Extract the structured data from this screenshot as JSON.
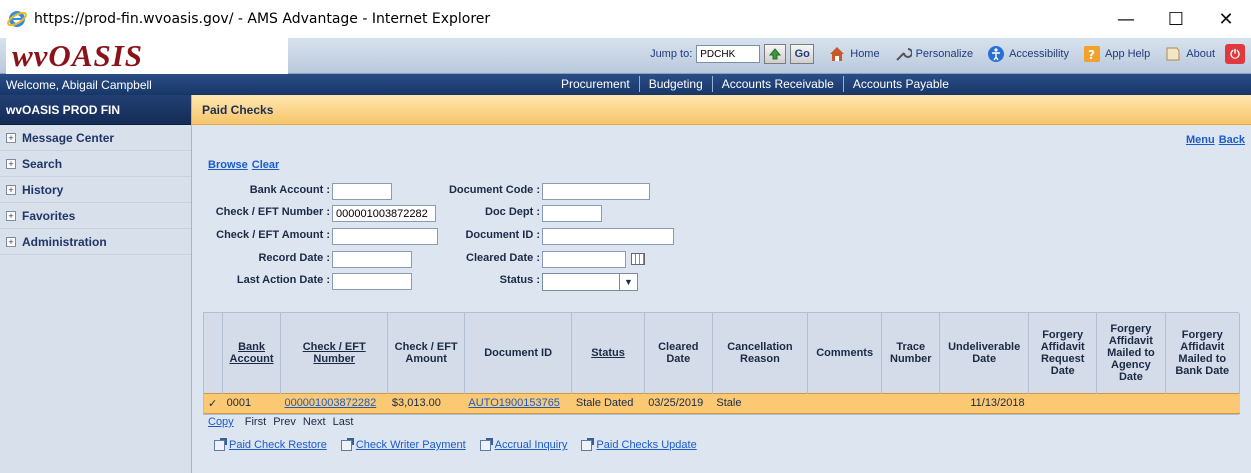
{
  "window": {
    "title": "https://prod-fin.wvoasis.gov/ - AMS Advantage - Internet Explorer",
    "minimize": "—",
    "maximize": "☐",
    "close": "✕"
  },
  "header": {
    "logo": "wvOASIS",
    "jump_label": "Jump to:",
    "jump_value": "PDCHK",
    "go_label": "Go",
    "links": [
      "Home",
      "Personalize",
      "Accessibility",
      "App Help",
      "About"
    ]
  },
  "navbar": {
    "welcome": "Welcome, Abigail Campbell",
    "items": [
      "Procurement",
      "Budgeting",
      "Accounts Receivable",
      "Accounts Payable"
    ]
  },
  "sidebar": {
    "title": "wvOASIS PROD FIN",
    "items": [
      "Message Center",
      "Search",
      "History",
      "Favorites",
      "Administration"
    ]
  },
  "page": {
    "title": "Paid Checks",
    "menu_label": "Menu",
    "back_label": "Back",
    "browse_label": "Browse",
    "clear_label": "Clear"
  },
  "form": {
    "bank_account": {
      "label": "Bank Account :",
      "value": ""
    },
    "check_eft_number": {
      "label": "Check / EFT Number :",
      "value": "000001003872282"
    },
    "check_eft_amount": {
      "label": "Check / EFT Amount :",
      "value": ""
    },
    "record_date": {
      "label": "Record Date :",
      "value": ""
    },
    "last_action_date": {
      "label": "Last Action Date :",
      "value": ""
    },
    "document_code": {
      "label": "Document Code :",
      "value": ""
    },
    "doc_dept": {
      "label": "Doc Dept :",
      "value": ""
    },
    "document_id": {
      "label": "Document ID :",
      "value": ""
    },
    "cleared_date": {
      "label": "Cleared Date :",
      "value": ""
    },
    "status": {
      "label": "Status :",
      "value": ""
    }
  },
  "grid": {
    "headers": [
      "Bank Account",
      "Check / EFT Number",
      "Check / EFT Amount",
      "Document ID",
      "Status",
      "Cleared Date",
      "Cancellation Reason",
      "Comments",
      "Trace Number",
      "Undeliverable Date",
      "Forgery Affidavit Request Date",
      "Forgery Affidavit Mailed to Agency Date",
      "Forgery Affidavit Mailed to Bank Date"
    ],
    "row": {
      "check_mark": "✓",
      "bank_account": "0001",
      "check_eft_number": "000001003872282",
      "amount": "$3,013.00",
      "document_id": "AUTO1900153765",
      "status": "Stale Dated",
      "cleared_date": "03/25/2019",
      "cancellation_reason": "Stale",
      "comments": "",
      "trace_number": "",
      "undeliverable_date": "11/13/2018",
      "forgery_request": "",
      "forgery_agency": "",
      "forgery_bank": ""
    }
  },
  "pager": {
    "copy": "Copy",
    "first": "First",
    "prev": "Prev",
    "next": "Next",
    "last": "Last"
  },
  "actions": [
    "Paid Check Restore",
    "Check Writer Payment",
    "Accrual Inquiry",
    "Paid Checks Update"
  ]
}
